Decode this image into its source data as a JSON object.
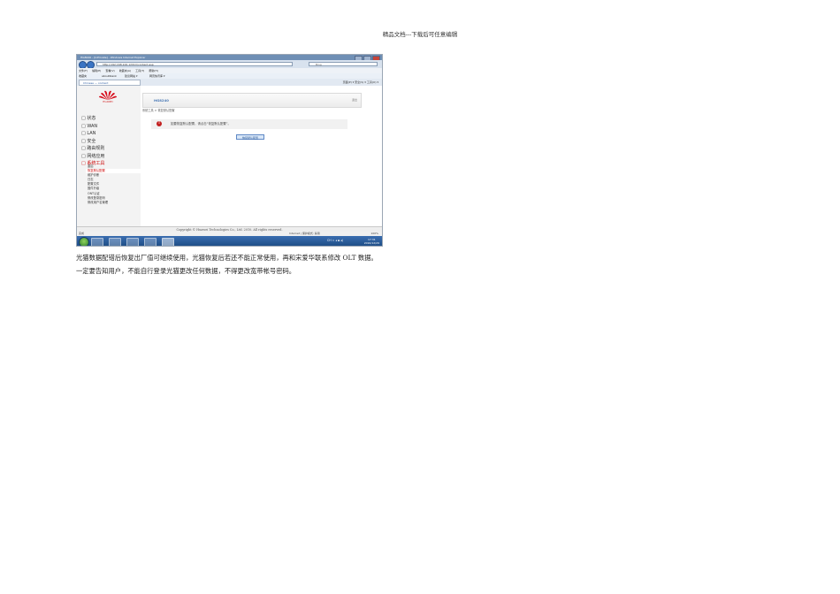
{
  "header": {
    "text": "精品文档---下载后可任意编辑"
  },
  "browser": {
    "window_title": "HG8240 - [InPrivate] - Windows Internet Explorer",
    "address": "http://192.168.100.1/html/content.asp",
    "search_placeholder": "Bing",
    "menu": [
      "文件(F)",
      "编辑(E)",
      "查看(V)",
      "收藏夹(A)",
      "工具(T)",
      "帮助(H)"
    ],
    "favorites": {
      "label": "收藏夹",
      "items": [
        "aboutblank",
        "建议网站 ▾",
        "网页快讯库 ▾"
      ]
    },
    "tab_title": "Chinese — content",
    "commandbar": "页面(P) ▾   安全(S) ▾   工具(O) ▾",
    "status_text": "完成",
    "zone_text": "Internet | 保护模式: 禁用",
    "zoom": "100%"
  },
  "router": {
    "brand": "HUAWEI",
    "model": "HG8240",
    "logout": "退出",
    "nav": [
      {
        "label": "□ 状态",
        "active": false
      },
      {
        "label": "□ WAN",
        "active": false
      },
      {
        "label": "□ LAN",
        "active": false
      },
      {
        "label": "□ 安全",
        "active": false
      },
      {
        "label": "□ 路由规则",
        "active": false
      },
      {
        "label": "□ 网络应用",
        "active": false
      },
      {
        "label": "□ 系统工具",
        "active": true
      }
    ],
    "subnav": [
      {
        "label": "重启",
        "active": false
      },
      {
        "label": "恢复默认配置",
        "active": true
      },
      {
        "label": "维护诊断",
        "active": false
      },
      {
        "label": "日志",
        "active": false
      },
      {
        "label": "配置文件",
        "active": false
      },
      {
        "label": "固件升级",
        "active": false
      },
      {
        "label": "ONT认证",
        "active": false
      },
      {
        "label": "修改登录密码",
        "active": false
      },
      {
        "label": "修改用户名管理",
        "active": false
      }
    ],
    "breadcrumb": "系统工具 > 恢复默认配置",
    "notice": "如要恢复默认配置，请点击“恢复默认配置”。",
    "restore_button": "恢复默认配置",
    "copyright": "Copyright © Huawei Technologies Co., Ltd. 2010. All rights reserved."
  },
  "taskbar": {
    "clock_time": "17:31",
    "clock_date": "2016/12/29",
    "tray": "CH ≈ ◂ ▪ ◂)"
  },
  "caption": {
    "line1": "光猫数据配错后恢复出厂值可继续使用，光猫恢复后若还不能正常使用，再和宋爱华联系修改 OLT 数据。",
    "line2": "一定要告知用户，不能自行登录光猫更改任何数据，不得更改宽带帐号密码。"
  }
}
